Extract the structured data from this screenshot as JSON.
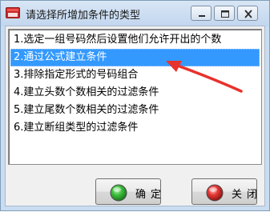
{
  "window": {
    "title": "请选择所增加条件的类型"
  },
  "titlebar_buttons": {
    "minimize": "minimize",
    "maximize": "maximize",
    "close": "close"
  },
  "options": [
    "1.选定一组号码然后设置他们允许开出的个数",
    "2.通过公式建立条件",
    "3.排除指定形式的号码组合",
    "4.建立头数个数相关的过滤条件",
    "5.建立尾数个数相关的过滤条件",
    "6.建立断组类型的过滤条件"
  ],
  "selected_index": 1,
  "buttons": {
    "ok_label": "确定",
    "close_label": "关闭"
  },
  "colors": {
    "selection": "#3399ff",
    "annotation_arrow": "#e8322d",
    "ok_gem": "#2ea043",
    "close_gem": "#d92b2b"
  }
}
